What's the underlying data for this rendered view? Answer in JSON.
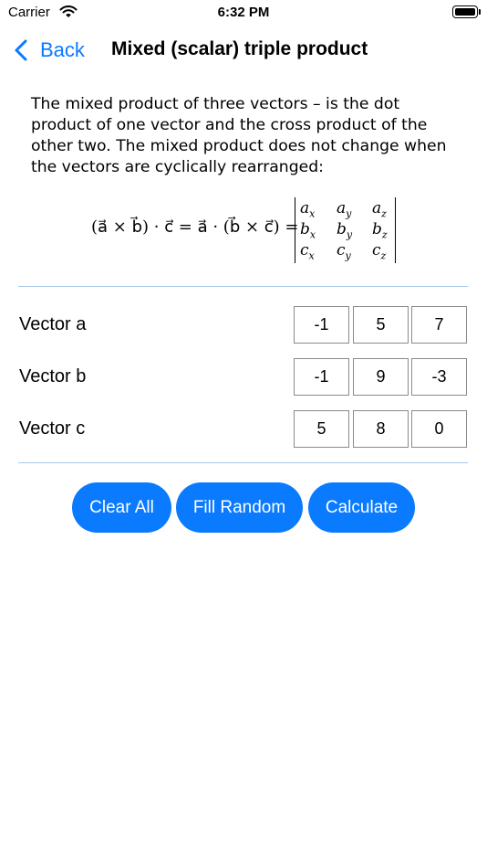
{
  "status": {
    "carrier": "Carrier",
    "time": "6:32 PM"
  },
  "nav": {
    "back_label": "Back",
    "title": "Mixed (scalar) triple product"
  },
  "description": "The mixed product of three vectors – is the dot product of one vector and the cross product of the other two. The mixed product does not change when the vectors are cyclically rearranged:",
  "formula": {
    "lhs": "(a⃗ × b⃗) · c⃗ = a⃗ · (b⃗ × c⃗) =",
    "matrix": [
      [
        "a",
        "x",
        "a",
        "y",
        "a",
        "z"
      ],
      [
        "b",
        "x",
        "b",
        "y",
        "b",
        "z"
      ],
      [
        "c",
        "x",
        "c",
        "y",
        "c",
        "z"
      ]
    ]
  },
  "vectors": [
    {
      "label": "Vector a",
      "values": [
        "-1",
        "5",
        "7"
      ]
    },
    {
      "label": "Vector b",
      "values": [
        "-1",
        "9",
        "-3"
      ]
    },
    {
      "label": "Vector c",
      "values": [
        "5",
        "8",
        "0"
      ]
    }
  ],
  "buttons": {
    "clear": "Clear All",
    "fill": "Fill Random",
    "calculate": "Calculate"
  },
  "colors": {
    "accent": "#0a7aff",
    "divider": "#a7c7e7"
  }
}
